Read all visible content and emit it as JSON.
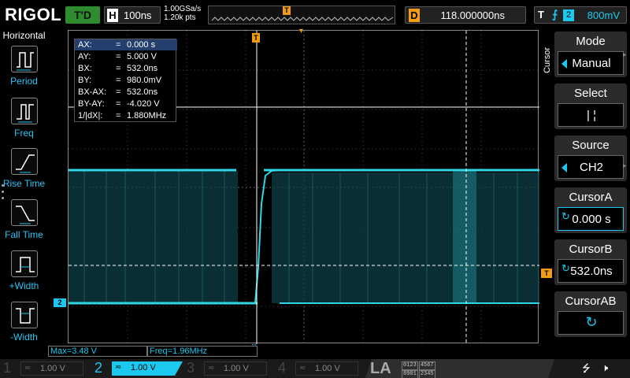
{
  "header": {
    "brand": "RIGOL",
    "run_status": "T'D",
    "horizontal_label": "H",
    "timebase": "100ns",
    "sample_rate": "1.00GSa/s",
    "memory_depth": "1.20k pts",
    "delay_label": "D",
    "delay_value": "118.000000ns",
    "trigger_label": "T",
    "trigger_source": "2",
    "trigger_level": "800mV",
    "trigger_pos_marker": "T"
  },
  "left_menu": {
    "title": "Horizontal",
    "items": [
      {
        "label": "Period"
      },
      {
        "label": "Freq"
      },
      {
        "label": "Rise Time"
      },
      {
        "label": "Fall Time"
      },
      {
        "label": "+Width"
      },
      {
        "label": "-Width"
      }
    ]
  },
  "cursor_readout": [
    {
      "key": "AX:",
      "value": "0.000 s"
    },
    {
      "key": "AY:",
      "value": "5.000 V"
    },
    {
      "key": "BX:",
      "value": "532.0ns"
    },
    {
      "key": "BY:",
      "value": "980.0mV"
    },
    {
      "key": "BX-AX:",
      "value": "532.0ns"
    },
    {
      "key": "BY-AY:",
      "value": "-4.020 V"
    },
    {
      "key": "1/|dX|:",
      "value": "1.880MHz"
    }
  ],
  "right_menu": {
    "side_label": "Cursor",
    "mode": {
      "title": "Mode",
      "value": "Manual"
    },
    "select": {
      "title": "Select",
      "value": "|  ¦"
    },
    "source": {
      "title": "Source",
      "value": "CH2"
    },
    "cursor_a": {
      "title": "CursorA",
      "value": "0.000 s"
    },
    "cursor_b": {
      "title": "CursorB",
      "value": "532.0ns"
    },
    "cursor_ab": {
      "title": "CursorAB",
      "value": "↻"
    }
  },
  "measurements": {
    "max": "Max=3.48 V",
    "freq": "Freq=1.96MHz"
  },
  "markers": {
    "ch2_offset": "2",
    "trigger_level": "T"
  },
  "channels": [
    {
      "num": "1",
      "coupling": "≂",
      "scale": "1.00 V",
      "active": false
    },
    {
      "num": "2",
      "coupling": "≂",
      "scale": "1.00 V",
      "active": true
    },
    {
      "num": "3",
      "coupling": "≂",
      "scale": "1.00 V",
      "active": false
    },
    {
      "num": "4",
      "coupling": "≂",
      "scale": "1.00 V",
      "active": false
    }
  ],
  "la": {
    "label": "LA",
    "grid_row1": [
      "0123",
      "4567"
    ],
    "grid_row2": [
      "8901",
      "2345"
    ]
  },
  "icons": {
    "usb": "usb-icon",
    "speaker": "speaker-muted-icon"
  },
  "colors": {
    "ch2": "#1ac8f0",
    "trigger": "#f39c12",
    "run_status": "#2e8b2e",
    "waveform": "#2fd6e6"
  }
}
